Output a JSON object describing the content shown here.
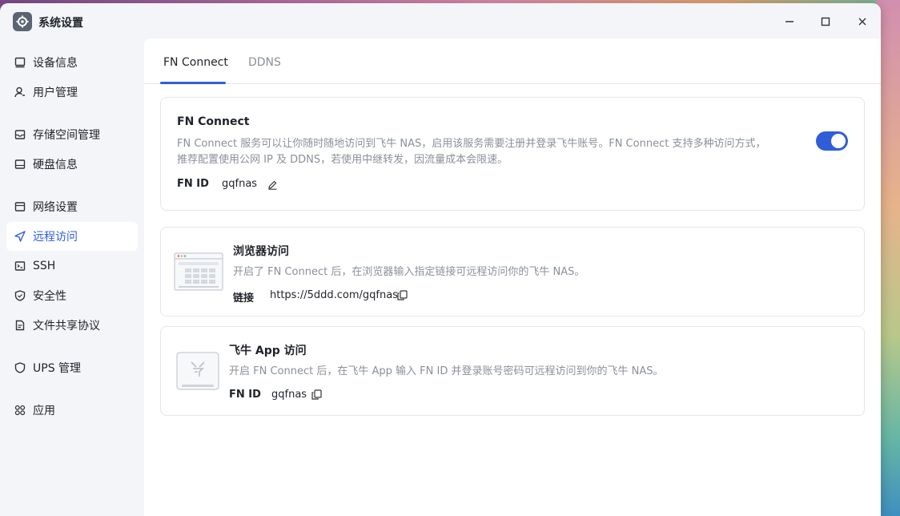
{
  "window": {
    "title": "系统设置"
  },
  "sidebar": {
    "items": [
      {
        "label": "设备信息"
      },
      {
        "label": "用户管理"
      },
      {
        "label": "存储空间管理"
      },
      {
        "label": "硬盘信息"
      },
      {
        "label": "网络设置"
      },
      {
        "label": "远程访问"
      },
      {
        "label": "SSH"
      },
      {
        "label": "安全性"
      },
      {
        "label": "文件共享协议"
      },
      {
        "label": "UPS 管理"
      },
      {
        "label": "应用"
      }
    ]
  },
  "tabs": [
    {
      "label": "FN Connect"
    },
    {
      "label": "DDNS"
    }
  ],
  "fn_connect": {
    "title": "FN Connect",
    "desc_line1": "FN Connect 服务可以让你随时随地访问到飞牛 NAS，启用该服务需要注册并登录飞牛账号。FN Connect 支持多种访问方式，",
    "desc_line2": "推荐配置使用公网 IP 及 DDNS，若使用中继转发，因流量成本会限速。",
    "id_key": "FN ID",
    "id_value": "gqfnas",
    "enabled": true
  },
  "browser_access": {
    "title": "浏览器访问",
    "desc": "开启了 FN Connect 后，在浏览器输入指定链接可远程访问你的飞牛 NAS。",
    "link_key": "链接",
    "link_value": "https://5ddd.com/gqfnas"
  },
  "app_access": {
    "title": "飞牛 App 访问",
    "desc": "开启 FN Connect 后，在飞牛 App 输入 FN ID 并登录账号密码可远程访问到你的飞牛 NAS。",
    "id_key": "FN ID",
    "id_value": "gqfnas"
  },
  "colors": {
    "accent": "#2f5ed8",
    "muted_text": "#8a9099",
    "text": "#1f2329"
  }
}
